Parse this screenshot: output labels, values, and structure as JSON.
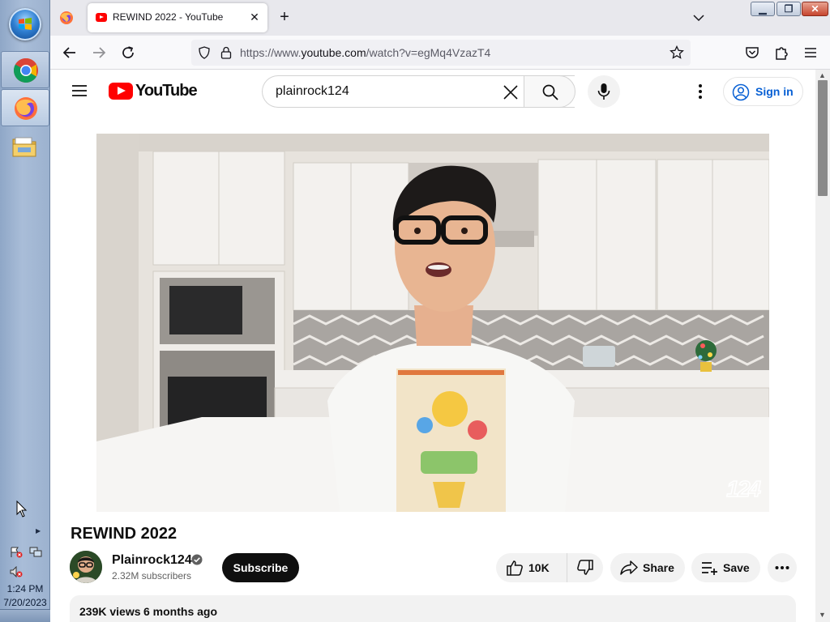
{
  "taskbar": {
    "apps": [
      "Google Chrome",
      "Mozilla Firefox",
      "Windows Explorer"
    ],
    "clock": {
      "time": "1:24 PM",
      "date": "7/20/2023"
    }
  },
  "browser": {
    "tab": {
      "title": "REWIND 2022 - YouTube"
    },
    "url": {
      "prefix": "https://www.",
      "host": "youtube.com",
      "path": "/watch?v=egMq4VzazT4"
    }
  },
  "youtube": {
    "logo_text": "YouTube",
    "search": {
      "value": "plainrock124"
    },
    "sign_in_label": "Sign in",
    "video": {
      "title": "REWIND 2022",
      "watermark": "124"
    },
    "channel": {
      "name": "Plainrock124",
      "subscribers": "2.32M subscribers",
      "subscribe_label": "Subscribe"
    },
    "actions": {
      "likes": "10K",
      "share_label": "Share",
      "save_label": "Save"
    },
    "description": {
      "views": "239K views",
      "date": "6 months ago"
    }
  },
  "colors": {
    "youtube_red": "#ff0000",
    "link_blue": "#065fd4",
    "taskbar_blue": "#a9bdd8"
  }
}
